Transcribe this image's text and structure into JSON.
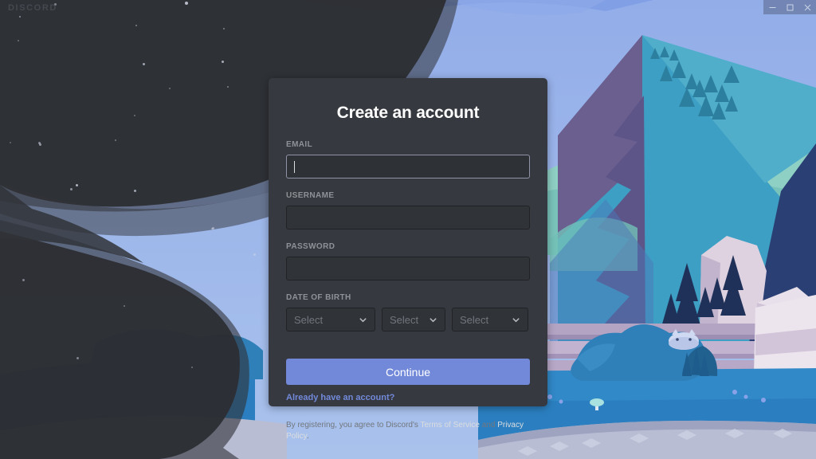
{
  "window": {
    "wordmark": "DISCORD",
    "controls": [
      {
        "name": "minimize",
        "glyph": "minimize-icon"
      },
      {
        "name": "maximize",
        "glyph": "maximize-icon"
      },
      {
        "name": "close",
        "glyph": "close-icon"
      }
    ]
  },
  "modal": {
    "title": "Create an account",
    "fields": [
      {
        "label": "EMAIL",
        "value": "",
        "placeholder": "",
        "focused": true
      },
      {
        "label": "USERNAME",
        "value": "",
        "placeholder": "",
        "focused": false
      },
      {
        "label": "PASSWORD",
        "value": "",
        "placeholder": "",
        "focused": false
      }
    ],
    "dob": {
      "label": "DATE OF BIRTH",
      "month": {
        "value": "Select"
      },
      "day": {
        "value": "Select"
      },
      "year": {
        "value": "Select"
      }
    },
    "continue_label": "Continue",
    "login_link": "Already have an account?",
    "legal": {
      "prefix": "By registering, you agree to Discord's ",
      "tos": "Terms of Service",
      "conjunction": " and ",
      "privacy": "Privacy Policy",
      "suffix": "."
    }
  },
  "colors": {
    "blurple": "#7289da",
    "modal_bg": "#36393f",
    "input_bg": "#303338",
    "label": "#8e9297",
    "sky": "#8ca8e8"
  }
}
